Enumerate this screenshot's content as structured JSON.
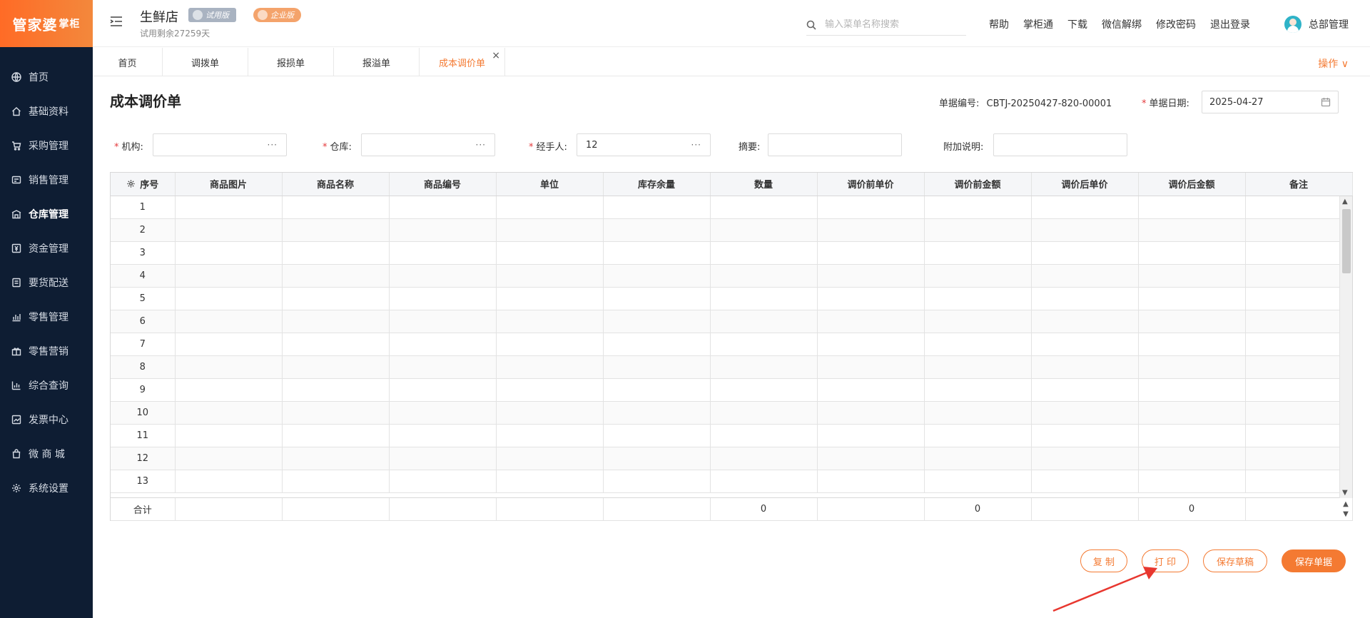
{
  "sidebar": {
    "logo_main": "管家婆",
    "logo_sub": "掌柜",
    "items": [
      {
        "label": "首页",
        "icon": "globe-icon"
      },
      {
        "label": "基础资料",
        "icon": "home-icon"
      },
      {
        "label": "采购管理",
        "icon": "cart-icon"
      },
      {
        "label": "销售管理",
        "icon": "sales-icon"
      },
      {
        "label": "仓库管理",
        "icon": "warehouse-icon",
        "active": true
      },
      {
        "label": "资金管理",
        "icon": "money-icon"
      },
      {
        "label": "要货配送",
        "icon": "list-icon"
      },
      {
        "label": "零售管理",
        "icon": "chart-icon"
      },
      {
        "label": "零售营销",
        "icon": "gift-icon"
      },
      {
        "label": "综合查询",
        "icon": "bar-chart-icon"
      },
      {
        "label": "发票中心",
        "icon": "invoice-icon"
      },
      {
        "label": "微 商 城",
        "icon": "bag-icon"
      },
      {
        "label": "系统设置",
        "icon": "gear-icon"
      }
    ]
  },
  "header": {
    "shop_name": "生鲜店",
    "trial_badge": "试用版",
    "enterprise_badge": "企业版",
    "trial_left": "试用剩余27259天",
    "search_placeholder": "输入菜单名称搜索",
    "links": [
      "帮助",
      "掌柜通",
      "下载",
      "微信解绑",
      "修改密码",
      "退出登录"
    ],
    "user_name": "总部管理"
  },
  "tabs": {
    "items": [
      "首页",
      "调拨单",
      "报损单",
      "报溢单",
      "成本调价单"
    ],
    "active_index": 4,
    "close_symbol": "×",
    "operations": "操作 ∨"
  },
  "form": {
    "title": "成本调价单",
    "doc_no_label": "单据编号:",
    "doc_no_value": "CBTJ-20250427-820-00001",
    "doc_date_label": "单据日期:",
    "doc_date_value": "2025-04-27",
    "org_label": "机构:",
    "org_value": "",
    "warehouse_label": "仓库:",
    "warehouse_value": "",
    "handler_label": "经手人:",
    "handler_value": "12",
    "summary_label": "摘要:",
    "summary_value": "",
    "extra_label": "附加说明:",
    "extra_value": "",
    "ellipsis": "···"
  },
  "table": {
    "columns": [
      "序号",
      "商品图片",
      "商品名称",
      "商品编号",
      "单位",
      "库存余量",
      "数量",
      "调价前单价",
      "调价前金额",
      "调价后单价",
      "调价后金额",
      "备注"
    ],
    "rows": [
      "1",
      "2",
      "3",
      "4",
      "5",
      "6",
      "7",
      "8",
      "9",
      "10",
      "11",
      "12",
      "13"
    ],
    "total_label": "合计",
    "total_qty": "0",
    "total_before_amount": "0",
    "total_after_amount": "0"
  },
  "actions": {
    "copy": "复 制",
    "print": "打 印",
    "save_draft": "保存草稿",
    "save_doc": "保存单据"
  }
}
